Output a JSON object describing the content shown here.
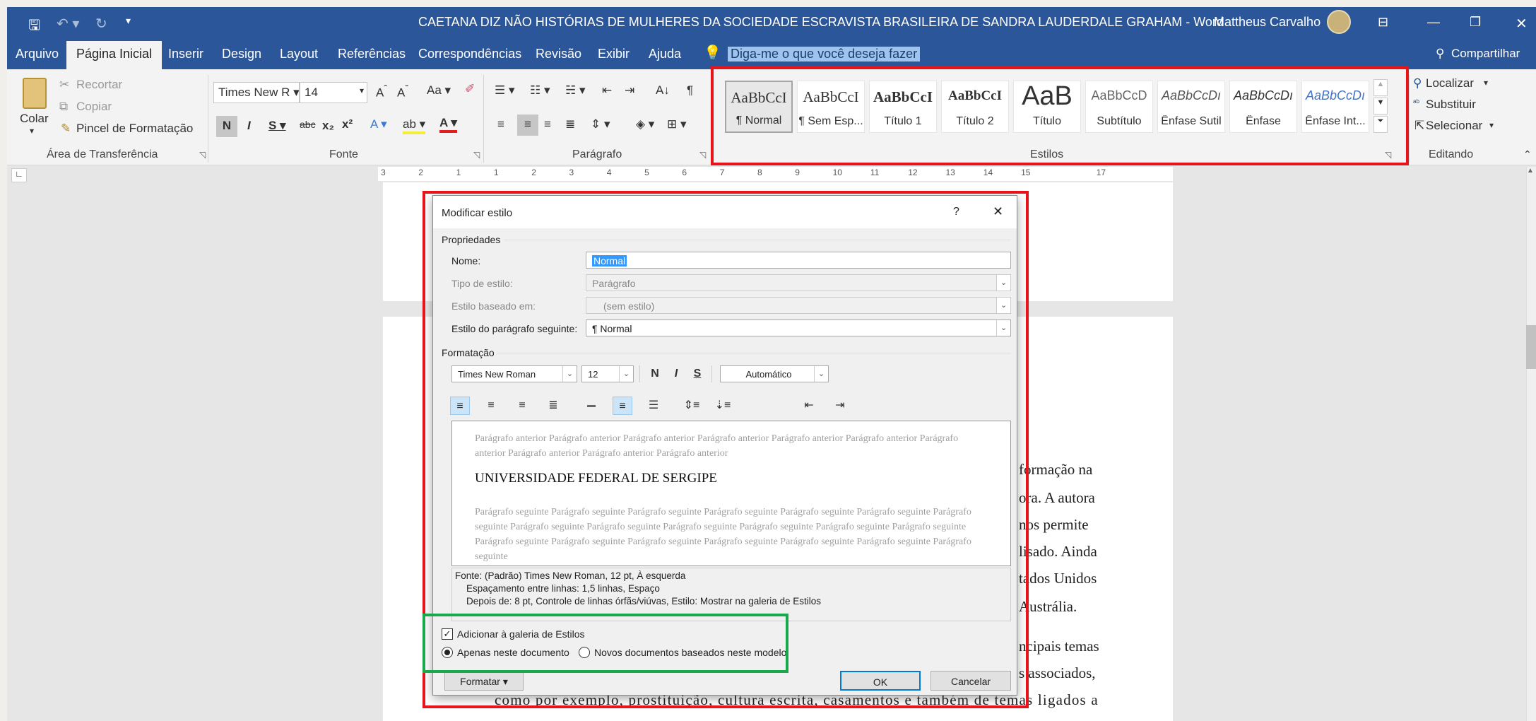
{
  "window": {
    "title": "CAETANA DIZ NÃO HISTÓRIAS DE MULHERES DA SOCIEDADE ESCRAVISTA BRASILEIRA DE SANDRA LAUDERDALE GRAHAM  -  Word",
    "user": "Mattheus Carvalho"
  },
  "menu": {
    "tabs": [
      "Arquivo",
      "Página Inicial",
      "Inserir",
      "Design",
      "Layout",
      "Referências",
      "Correspondências",
      "Revisão",
      "Exibir",
      "Ajuda"
    ],
    "tell_me": "Diga-me o que você deseja fazer",
    "share": "Compartilhar"
  },
  "ribbon": {
    "clipboard": {
      "paste": "Colar",
      "cut": "Recortar",
      "copy": "Copiar",
      "format_painter": "Pincel de Formatação",
      "group": "Área de Transferência"
    },
    "font": {
      "name": "Times New R",
      "size": "14",
      "group": "Fonte"
    },
    "paragraph": {
      "group": "Parágrafo"
    },
    "styles": {
      "group": "Estilos",
      "items": [
        {
          "preview": "AaBbCcI",
          "name": "¶ Normal"
        },
        {
          "preview": "AaBbCcI",
          "name": "¶ Sem Esp..."
        },
        {
          "preview": "AaBbCcI",
          "name": "Título 1"
        },
        {
          "preview": "AaBbCcI",
          "name": "Título 2"
        },
        {
          "preview": "AaB",
          "name": "Título"
        },
        {
          "preview": "AaBbCcD",
          "name": "Subtítulo"
        },
        {
          "preview": "AaBbCcDı",
          "name": "Ênfase Sutil"
        },
        {
          "preview": "AaBbCcDı",
          "name": "Ênfase"
        },
        {
          "preview": "AaBbCcDı",
          "name": "Ênfase Int..."
        }
      ]
    },
    "editing": {
      "find": "Localizar",
      "replace": "Substituir",
      "select": "Selecionar",
      "group": "Editando"
    }
  },
  "ruler": {
    "numbers": [
      "3",
      "2",
      "1",
      "1",
      "2",
      "3",
      "4",
      "5",
      "6",
      "7",
      "8",
      "9",
      "10",
      "11",
      "12",
      "13",
      "14",
      "15",
      "17"
    ]
  },
  "document": {
    "right_fragments": [
      "formação na",
      "ora. A autora",
      "nos permite",
      "lisado. Ainda",
      "tados Unidos",
      "Austrália.",
      "ncipais temas",
      "s associados,"
    ],
    "bottom_line": "como por exemplo, prostituição, cultura escrita, casamentos e também de temas ligados a"
  },
  "dialog": {
    "title": "Modificar estilo",
    "help": "?",
    "close": "✕",
    "properties_header": "Propriedades",
    "name_label": "Nome:",
    "name_value": "Normal",
    "type_label": "Tipo de estilo:",
    "type_value": "Parágrafo",
    "based_label": "Estilo baseado em:",
    "based_value": "(sem estilo)",
    "next_label": "Estilo do parágrafo seguinte:",
    "next_value": "¶  Normal",
    "format_header": "Formatação",
    "font_value": "Times New Roman",
    "size_value": "12",
    "bold": "N",
    "italic": "I",
    "underline": "S",
    "color_value": "Automático",
    "preview_prev": "Parágrafo anterior Parágrafo anterior Parágrafo anterior Parágrafo anterior Parágrafo anterior Parágrafo anterior Parágrafo anterior Parágrafo anterior Parágrafo anterior Parágrafo anterior",
    "preview_main": "UNIVERSIDADE FEDERAL DE SERGIPE",
    "preview_next": "Parágrafo seguinte Parágrafo seguinte Parágrafo seguinte Parágrafo seguinte Parágrafo seguinte Parágrafo seguinte Parágrafo seguinte Parágrafo seguinte Parágrafo seguinte Parágrafo seguinte Parágrafo seguinte Parágrafo seguinte Parágrafo seguinte Parágrafo seguinte Parágrafo seguinte Parágrafo seguinte Parágrafo seguinte Parágrafo seguinte Parágrafo seguinte Parágrafo seguinte",
    "desc_line1": "Fonte: (Padrão) Times New Roman, 12 pt, À esquerda",
    "desc_line2": "Espaçamento entre linhas:  1,5 linhas, Espaço",
    "desc_line3": "Depois de:  8 pt, Controle de linhas órfãs/viúvas, Estilo: Mostrar na galeria de Estilos",
    "add_gallery": "Adicionar à galeria de Estilos",
    "only_doc": "Apenas neste documento",
    "new_docs": "Novos documentos baseados neste modelo",
    "format_button": "Formatar ▾",
    "ok": "OK",
    "cancel": "Cancelar"
  },
  "colors": {
    "accent": "#2b579a",
    "highlight_red": "#e8141b",
    "highlight_green": "#1aa84c"
  }
}
